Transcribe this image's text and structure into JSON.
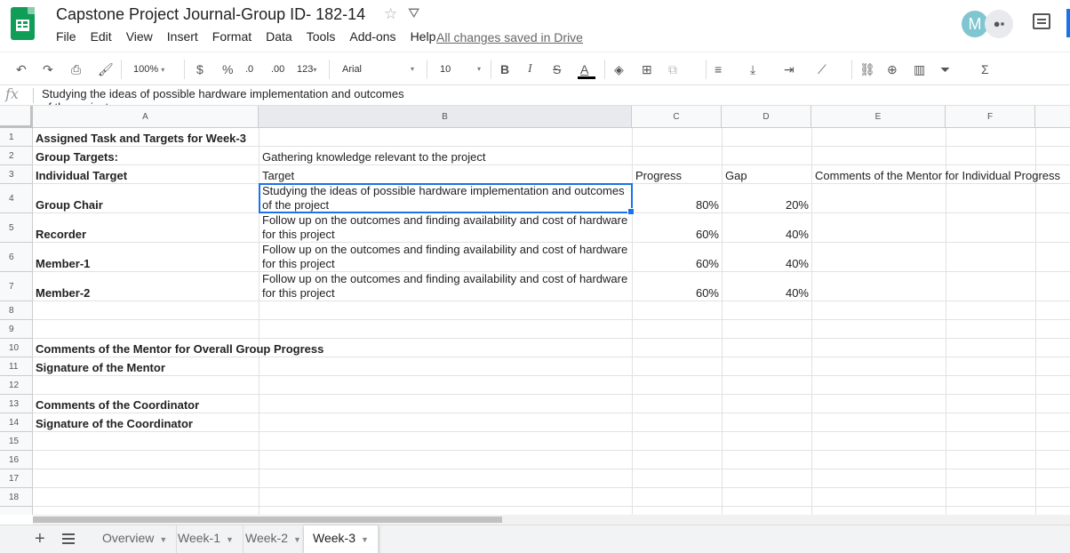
{
  "window": {
    "title": "Capstone Project Journal-Group ID- 182-14",
    "saved_status": "All changes saved in Drive",
    "avatar_letter": "M"
  },
  "menu": [
    "File",
    "Edit",
    "View",
    "Insert",
    "Format",
    "Data",
    "Tools",
    "Add-ons",
    "Help"
  ],
  "toolbar": {
    "zoom": "100%",
    "currency": "$",
    "percent": "%",
    "dec_decrease": ".0",
    "dec_increase": ".00",
    "more_formats": "123",
    "font": "Arial",
    "font_size": "10",
    "bold": "B",
    "italic": "I",
    "strike": "S",
    "text_color": "A",
    "function": "Σ"
  },
  "formula_bar": {
    "fx": "fx",
    "content": "Studying the ideas of possible hardware implementation and outcomes of the project"
  },
  "columns": [
    "A",
    "B",
    "C",
    "D",
    "E",
    "F"
  ],
  "rows": [
    "1",
    "2",
    "3",
    "4",
    "5",
    "6",
    "7",
    "8",
    "9",
    "10",
    "11",
    "12",
    "13",
    "14",
    "15",
    "16",
    "17",
    "18"
  ],
  "cells": {
    "a1": "Assigned Task and Targets for Week-3",
    "a2": "Group Targets:",
    "b2": "Gathering knowledge relevant to the project",
    "a3": "Individual Target",
    "b3": "Target",
    "c3": "Progress",
    "d3": "Gap",
    "e3": "Comments of the Mentor for Individual Progress",
    "a4": "Group Chair",
    "b4_l1": "Studying the ideas of possible hardware implementation and outcomes",
    "b4_l2": "of the project",
    "c4": "80%",
    "d4": "20%",
    "a5": "Recorder",
    "b5_l1": "Follow up on the outcomes and finding availability and cost of hardware",
    "b5_l2": "for this project",
    "c5": "60%",
    "d5": "40%",
    "a6": "Member-1",
    "b6_l1": "Follow up on the outcomes and finding availability and cost of hardware",
    "b6_l2": "for this project",
    "c6": "60%",
    "d6": "40%",
    "a7": "Member-2",
    "b7_l1": "Follow up on the outcomes and finding availability and cost of hardware",
    "b7_l2": "for this project",
    "c7": "60%",
    "d7": "40%",
    "a10": "Comments of the Mentor for Overall Group Progress",
    "a11": "Signature of the Mentor",
    "a13": "Comments of the Coordinator",
    "a14": "Signature of the Coordinator"
  },
  "sheets": [
    "Overview",
    "Week-1",
    "Week-2",
    "Week-3"
  ],
  "active_sheet": "Week-3"
}
